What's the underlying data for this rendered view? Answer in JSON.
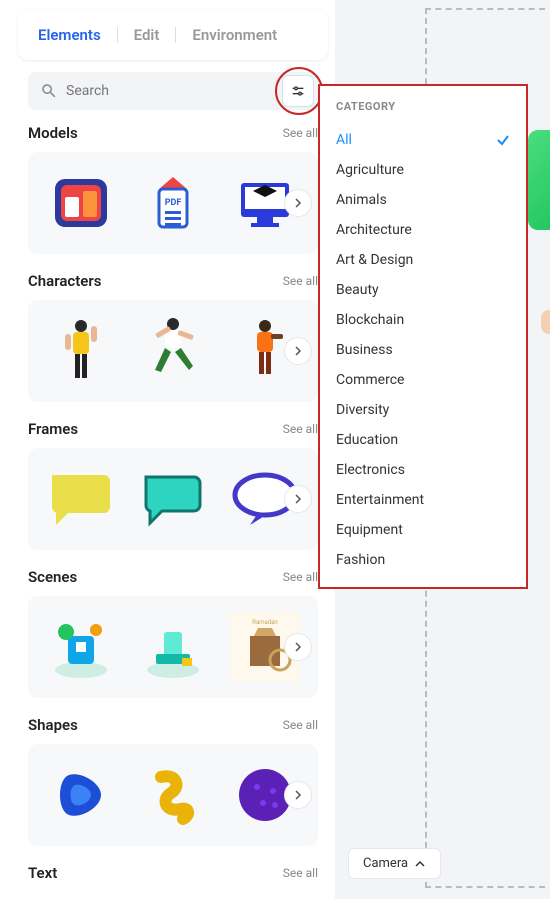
{
  "tabs": {
    "elements": "Elements",
    "edit": "Edit",
    "environment": "Environment"
  },
  "search": {
    "placeholder": "Search"
  },
  "sections": {
    "models": {
      "title": "Models",
      "see_all": "See all"
    },
    "characters": {
      "title": "Characters",
      "see_all": "See all"
    },
    "frames": {
      "title": "Frames",
      "see_all": "See all"
    },
    "scenes": {
      "title": "Scenes",
      "see_all": "See all"
    },
    "shapes": {
      "title": "Shapes",
      "see_all": "See all"
    },
    "text": {
      "title": "Text",
      "see_all": "See all"
    }
  },
  "category_popup": {
    "title": "CATEGORY",
    "items": [
      "All",
      "Agriculture",
      "Animals",
      "Architecture",
      "Art & Design",
      "Beauty",
      "Blockchain",
      "Business",
      "Commerce",
      "Diversity",
      "Education",
      "Electronics",
      "Entertainment",
      "Equipment",
      "Fashion"
    ],
    "selected": "All"
  },
  "camera": {
    "label": "Camera"
  }
}
